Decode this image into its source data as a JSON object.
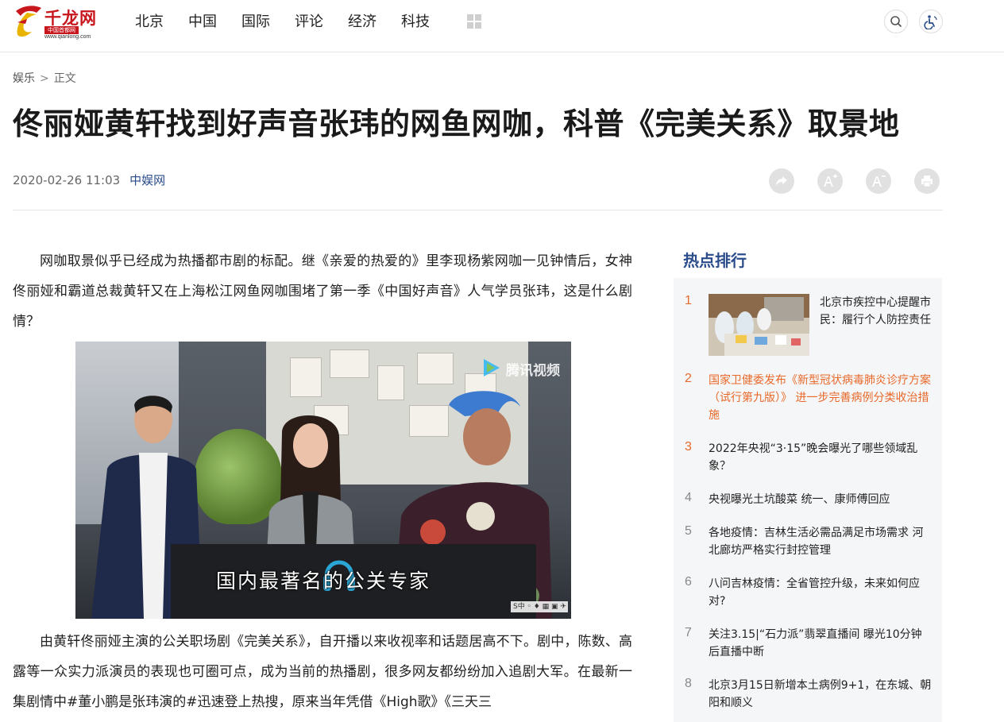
{
  "header": {
    "logo_name": "千龙网",
    "logo_tag": "中国首都网",
    "logo_url": "www.qianlong.com",
    "nav": [
      "北京",
      "中国",
      "国际",
      "评论",
      "经济",
      "科技"
    ]
  },
  "breadcrumb": {
    "section": "娱乐",
    "separator": ">",
    "current": "正文"
  },
  "article": {
    "title": "佟丽娅黄轩找到好声音张玮的网鱼网咖，科普《完美关系》取景地",
    "date": "2020-02-26 11:03",
    "source": "中娱网",
    "paragraph1": "网咖取景似乎已经成为热播都市剧的标配。继《亲爱的热爱的》里李现杨紫网咖一见钟情后，女神佟丽娅和霸道总裁黄轩又在上海松江网鱼网咖围堵了第一季《中国好声音》人气学员张玮，这是什么剧情？",
    "image_subtitle": "国内最著名的公关专家",
    "image_watermark": "腾讯视频",
    "paragraph2": "由黄轩佟丽娅主演的公关职场剧《完美关系》，自开播以来收视率和话题居高不下。剧中，陈数、高露等一众实力派演员的表现也可圈可点，成为当前的热播剧，很多网友都纷纷加入追剧大军。在最新一集剧情中#董小鹏是张玮演的#迅速登上热搜，原来当年凭借《High歌》《三天三"
  },
  "sidebar": {
    "title": "热点排行",
    "items": [
      {
        "num": "1",
        "text": "北京市疾控中心提醒市民：履行个人防控责任",
        "hot": true
      },
      {
        "num": "2",
        "text": "国家卫健委发布《新型冠状病毒肺炎诊疗方案（试行第九版）》 进一步完善病例分类收治措施",
        "hot": true
      },
      {
        "num": "3",
        "text": "2022年央视“3·15”晚会曝光了哪些领域乱象？",
        "hot": true
      },
      {
        "num": "4",
        "text": "央视曝光土坑酸菜 统一、康师傅回应",
        "hot": false
      },
      {
        "num": "5",
        "text": "各地疫情：吉林生活必需品满足市场需求 河北廊坊严格实行封控管理",
        "hot": false
      },
      {
        "num": "6",
        "text": "八问吉林疫情：全省管控升级，未来如何应对?",
        "hot": false
      },
      {
        "num": "7",
        "text": "关注3.15|“石力派”翡翠直播间 曝光10分钟后直播中断",
        "hot": false
      },
      {
        "num": "8",
        "text": "北京3月15日新增本土病例9+1，在东城、朝阳和顺义",
        "hot": false
      }
    ]
  },
  "colors": {
    "accent_red": "#c8161d",
    "link_blue": "#2a4c8a",
    "hot_orange": "#e8692a"
  }
}
